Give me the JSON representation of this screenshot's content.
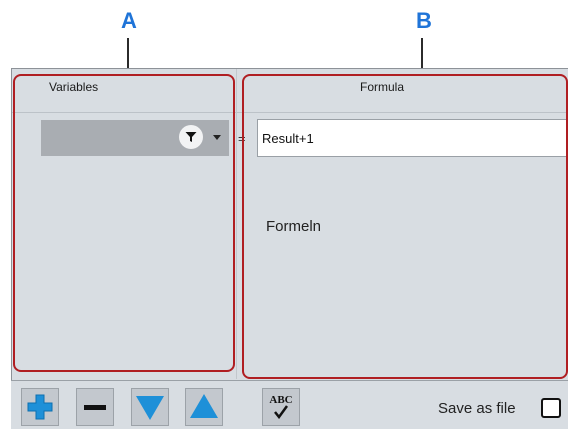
{
  "callouts": {
    "a": "A",
    "b": "B"
  },
  "variables_panel": {
    "header": "Variables"
  },
  "formula_panel": {
    "header": "Formula",
    "equals_sign": "=",
    "input_value": "Result+1",
    "caption": "Formeln"
  },
  "toolbar": {
    "buttons": [
      {
        "name": "add",
        "icon": "plus-icon"
      },
      {
        "name": "remove",
        "icon": "minus-icon"
      },
      {
        "name": "move-down",
        "icon": "arrow-down-icon"
      },
      {
        "name": "move-up",
        "icon": "arrow-up-icon"
      },
      {
        "name": "spell-check",
        "icon": "spellcheck-icon",
        "label": "ABC"
      }
    ],
    "save_as_file_label": "Save as file",
    "save_as_file_checked": false
  },
  "colors": {
    "callout": "#1f74d8",
    "highlight_border": "#b01e22",
    "arrow_blue": "#1e90d8"
  }
}
